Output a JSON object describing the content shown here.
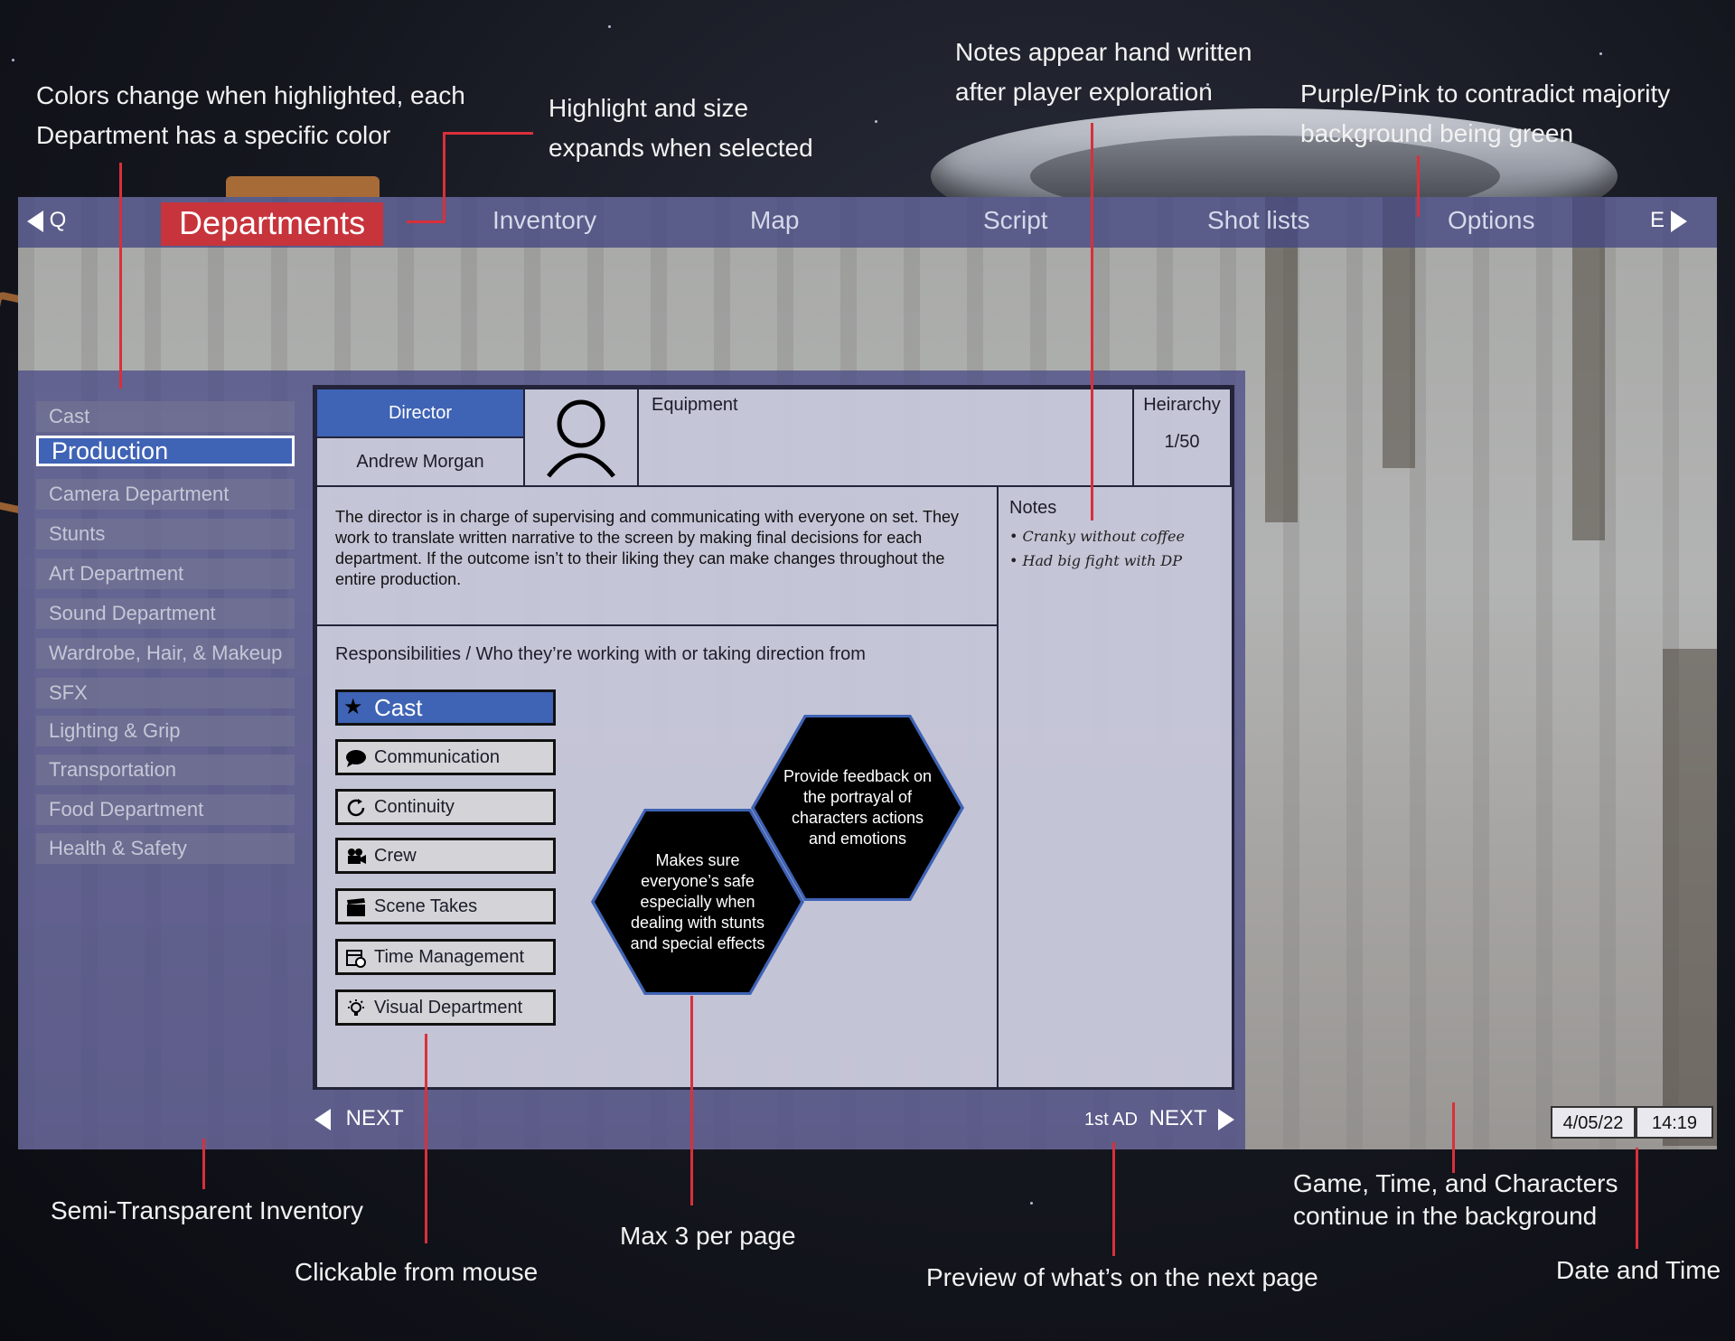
{
  "annotations": {
    "colors_change": [
      "Colors change when highlighted, each",
      "Department has a specific color"
    ],
    "highlight_size": [
      "Highlight and size",
      "expands when selected"
    ],
    "notes_hand": [
      "Notes appear hand written",
      "after player exploration"
    ],
    "purple_pink": [
      "Purple/Pink to contradict majority",
      "background being green"
    ],
    "semi_transparent": "Semi-Transparent Inventory",
    "clickable": "Clickable from mouse",
    "max3": "Max 3 per page",
    "preview": "Preview of what’s on the next page",
    "game_time": [
      "Game, Time, and Characters",
      "continue in the background"
    ],
    "date_time": "Date and Time"
  },
  "topbar": {
    "left_key": "Q",
    "right_key": "E",
    "tabs": [
      "Departments",
      "Inventory",
      "Map",
      "Script",
      "Shot lists",
      "Options"
    ]
  },
  "departments": [
    "Cast",
    "Production",
    "Camera Department",
    "Stunts",
    "Art Department",
    "Sound Department",
    "Wardrobe, Hair, & Makeup",
    "SFX",
    "Lighting & Grip",
    "Transportation",
    "Food Department",
    "Health & Safety"
  ],
  "card": {
    "role": "Director",
    "name": "Andrew Morgan",
    "equipment_label": "Equipment",
    "hierarchy_label": "Heirarchy",
    "hierarchy_value": "1/50",
    "description": "The director is in charge of supervising and communicating with everyone on set. They work to translate written narrative to the screen by making final decisions for each department. If the outcome isn’t to their liking they can make changes throughout the entire production.",
    "notes_label": "Notes",
    "notes": [
      "Cranky without coffee",
      "Had big fight with DP"
    ],
    "responsibilities_label": "Responsibilities / Who they’re working with or taking direction from",
    "responsibilities": [
      "Cast",
      "Communication",
      "Continuity",
      "Crew",
      "Scene Takes",
      "Time Management",
      "Visual Department"
    ],
    "hexes": [
      "Makes sure everyone’s safe especially when dealing with stunts and special effects",
      "Provide feedback on the portrayal of characters actions and emotions"
    ]
  },
  "nav": {
    "prev_label": "NEXT",
    "next_preview": "1st AD",
    "next_label": "NEXT"
  },
  "status": {
    "date": "4/05/22",
    "time": "14:19"
  },
  "colors": {
    "highlight_red": "#c7343c",
    "select_blue": "#3f63b5",
    "panel_purple": "#46468a",
    "annotation_line": "#d9303a"
  }
}
